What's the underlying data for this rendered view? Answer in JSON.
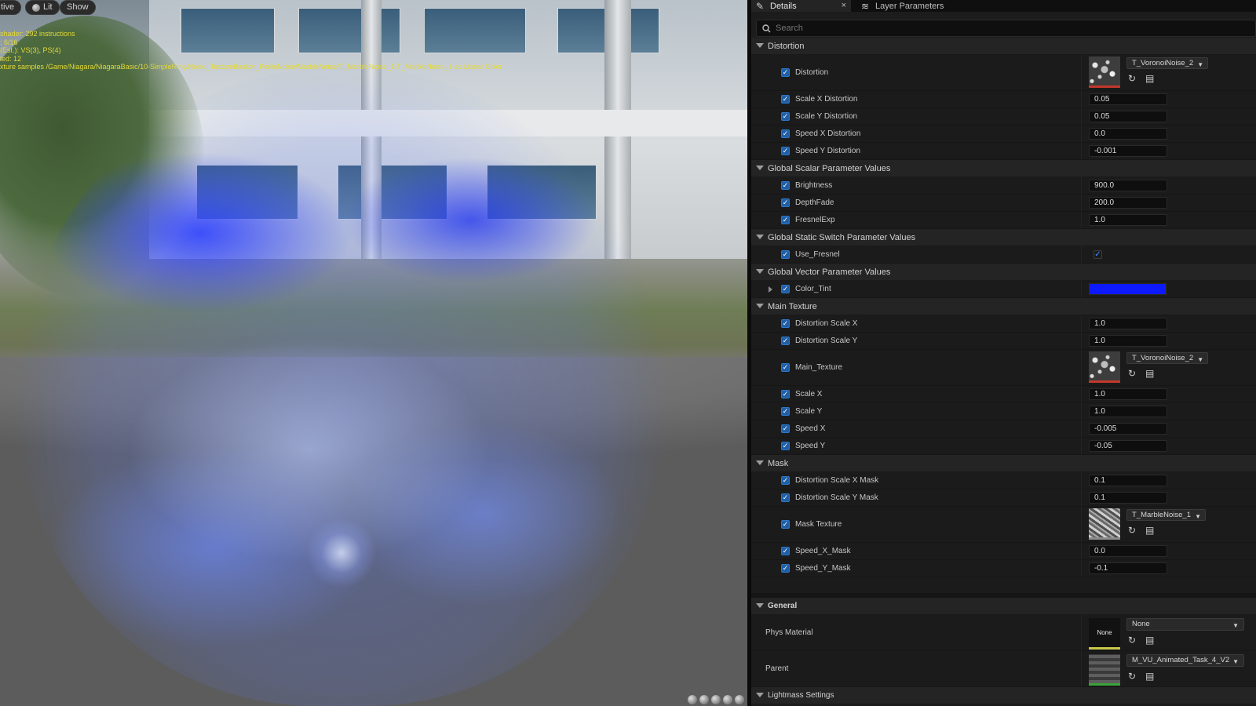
{
  "viewport": {
    "buttons": {
      "perspective": "tive",
      "lit": "Lit",
      "show": "Show"
    },
    "stats": [
      "shader: 292 instructions",
      ": 6/16",
      "(Est.): VS(3), PS(4)",
      "led: 12",
      "xture samples /Game/Niagara/NiagaraBasic/10-SimpleRing/Noise_TextureBasker_PerlinNoise/MarbleNoise/T_MarbleNoise_1.T_MarbleNoise_1 as Linear Color"
    ],
    "colors": {
      "stats_text": "#e3d936",
      "effect_blue": "#1f3cff"
    }
  },
  "panel": {
    "tabs": {
      "details": "Details",
      "layers": "Layer Parameters",
      "close_glyph": "×"
    },
    "search": {
      "placeholder": "Search"
    },
    "sections": {
      "distortion": {
        "title": "Distortion",
        "distortion_label": "Distortion",
        "distortion_asset": "T_VoronoiNoise_2",
        "scale_x_label": "Scale X Distortion",
        "scale_x": "0.05",
        "scale_y_label": "Scale Y Distortion",
        "scale_y": "0.05",
        "speed_x_label": "Speed X Distortion",
        "speed_x": "0.0",
        "speed_y_label": "Speed Y Distortion",
        "speed_y": "-0.001"
      },
      "scalar": {
        "title": "Global Scalar Parameter Values",
        "brightness_label": "Brightness",
        "brightness": "900.0",
        "depthfade_label": "DepthFade",
        "depthfade": "200.0",
        "fresnelexp_label": "FresnelExp",
        "fresnelexp": "1.0"
      },
      "switch": {
        "title": "Global Static Switch Parameter Values",
        "use_fresnel_label": "Use_Fresnel",
        "use_fresnel": true
      },
      "vector": {
        "title": "Global Vector Parameter Values",
        "color_tint_label": "Color_Tint",
        "color_tint": "#0d19ff"
      },
      "main_texture": {
        "title": "Main Texture",
        "dist_scale_x_label": "Distortion Scale X",
        "dist_scale_x": "1.0",
        "dist_scale_y_label": "Distortion Scale Y",
        "dist_scale_y": "1.0",
        "main_texture_label": "Main_Texture",
        "main_texture_asset": "T_VoronoiNoise_2",
        "scale_x_label": "Scale X",
        "scale_x": "1.0",
        "scale_y_label": "Scale Y",
        "scale_y": "1.0",
        "speed_x_label": "Speed X",
        "speed_x": "-0.005",
        "speed_y_label": "Speed Y",
        "speed_y": "-0.05"
      },
      "mask": {
        "title": "Mask",
        "dist_scale_x_mask_label": "Distortion Scale X Mask",
        "dist_scale_x_mask": "0.1",
        "dist_scale_y_mask_label": "Distortion Scale Y Mask",
        "dist_scale_y_mask": "0.1",
        "mask_texture_label": "Mask Texture",
        "mask_texture_asset": "T_MarbleNoise_1",
        "speed_x_mask_label": "Speed_X_Mask",
        "speed_x_mask": "0.0",
        "speed_y_mask_label": "Speed_Y_Mask",
        "speed_y_mask": "-0.1"
      },
      "general": {
        "title": "General",
        "phys_material_label": "Phys Material",
        "phys_material_thumb": "None",
        "phys_material": "None",
        "parent_label": "Parent",
        "parent": "M_VU_Animated_Task_4_V2"
      },
      "lightmass": {
        "title": "Lightmass Settings"
      }
    },
    "icons": {
      "search": "search-icon",
      "browse": "browse-arrow-icon",
      "folder": "folder-icon",
      "chevron": "chevron-down-icon"
    }
  }
}
